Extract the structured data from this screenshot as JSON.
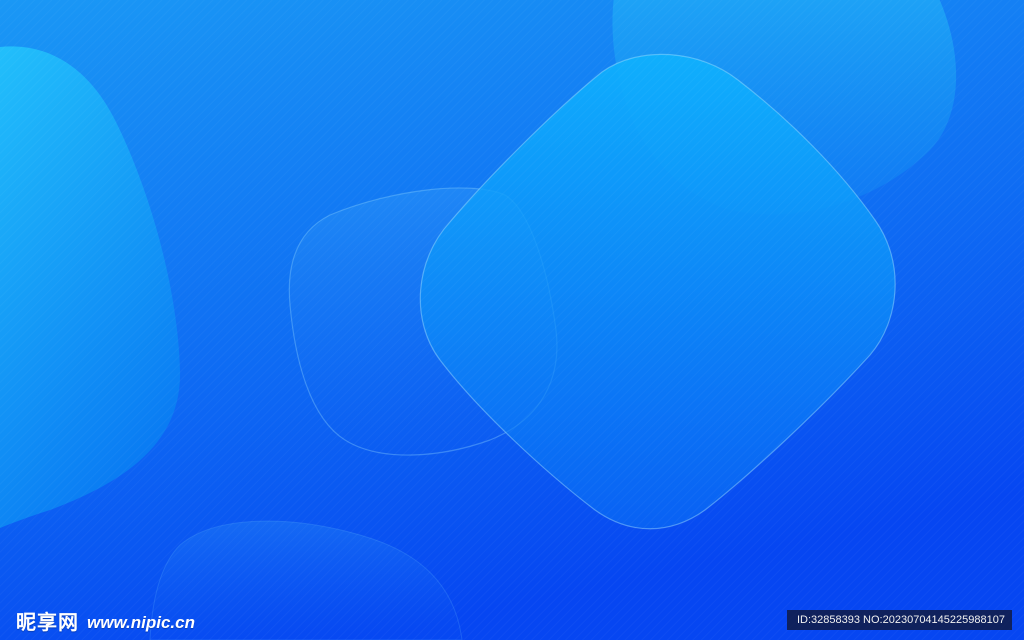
{
  "watermark": {
    "site_name_cn": "昵享网",
    "site_url": "www.nipic.cn",
    "id_text": "ID:32858393 NO:20230704145225988107"
  },
  "colors": {
    "background_top": "#1a98f5",
    "background_bottom": "#0646f2",
    "shape_light": "#2bc6fb",
    "shape_mid": "#12a6fb",
    "glass_stroke": "#8fd6ff",
    "watermark_bg": "#1a1a28"
  }
}
